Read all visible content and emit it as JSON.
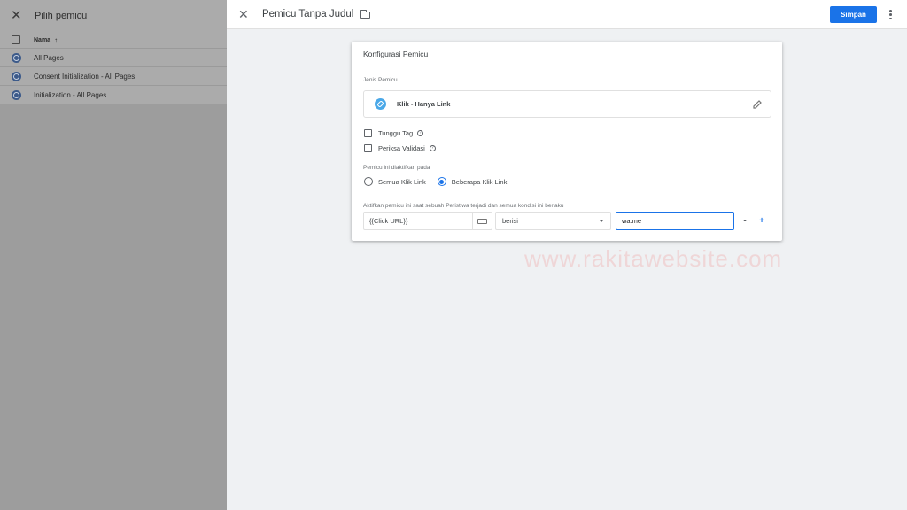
{
  "left_panel": {
    "title": "Pilih pemicu",
    "column_header": "Nama",
    "rows": [
      {
        "label": "All Pages"
      },
      {
        "label": "Consent Initialization - All Pages"
      },
      {
        "label": "Initialization - All Pages"
      }
    ]
  },
  "topbar": {
    "title": "Pemicu Tanpa Judul",
    "save_label": "Simpan"
  },
  "card": {
    "title": "Konfigurasi Pemicu",
    "type_section_label": "Jenis Pemicu",
    "trigger_type": "Klik - Hanya Link",
    "checkbox_wait_tags": "Tunggu Tag",
    "checkbox_check_validation": "Periksa Validasi",
    "fires_on_label": "Pemicu ini diaktifkan pada",
    "radio_all": "Semua Klik Link",
    "radio_some": "Beberapa Klik Link",
    "selected_radio": "Beberapa Klik Link",
    "condition_label": "Aktifkan pemicu ini saat sebuah Peristiwa terjadi dan semua kondisi ini berlaku",
    "condition": {
      "variable": "{{Click URL}}",
      "operator": "berisi",
      "value": "wa.me"
    },
    "remove_label": "-",
    "add_label": "+"
  },
  "watermark": "www.rakitawebsite.com",
  "colors": {
    "accent": "#1a73e8",
    "link_icon": "#4aa8e8"
  }
}
